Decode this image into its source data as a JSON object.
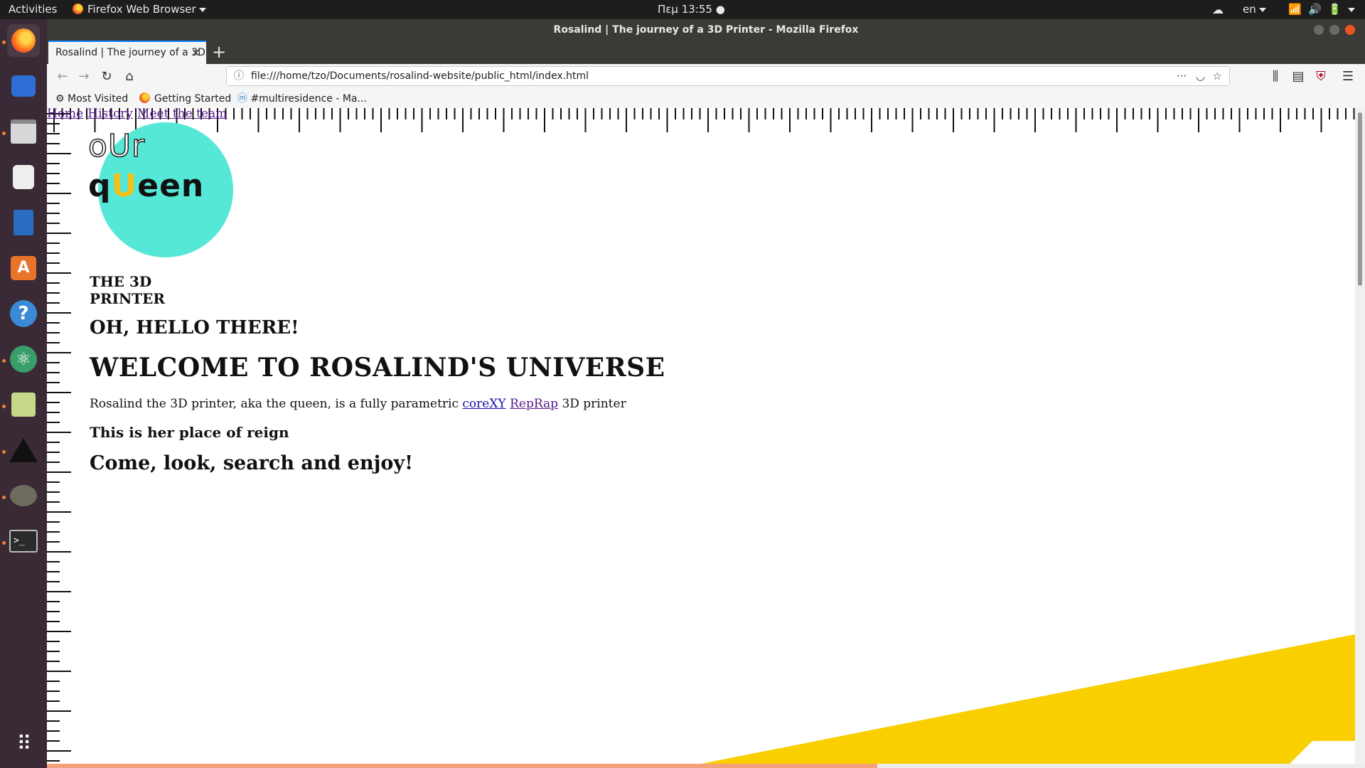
{
  "system_bar": {
    "activities": "Activities",
    "app_menu": "Firefox Web Browser",
    "clock": "Πεμ 13:55",
    "language": "en"
  },
  "window": {
    "title": "Rosalind | The journey of a 3D Printer - Mozilla Firefox"
  },
  "launcher": {
    "apps": [
      "firefox-icon",
      "thunderbird-icon",
      "files-icon",
      "rhythmbox-icon",
      "writer-icon",
      "software-center-icon",
      "help-icon",
      "atom-icon",
      "image-viewer-icon",
      "inkscape-icon",
      "gimp-icon",
      "terminal-icon",
      "app-grid-icon"
    ]
  },
  "tab": {
    "label": "Rosalind | The journey of a 3D Printer",
    "close": "×",
    "new_tab": "+"
  },
  "nav": {
    "url": "file:///home/tzo/Documents/rosalind-website/public_html/index.html",
    "more": "···"
  },
  "bookmarks": [
    "Most Visited",
    "Getting Started",
    "#multiresidence - Ma..."
  ],
  "page": {
    "nav_links": [
      "Home",
      "History",
      "Meet the team"
    ],
    "logo_line1": {
      "a": "o",
      "b": "U",
      "c": "r"
    },
    "logo_line2": {
      "a": "q",
      "b": "U",
      "c": "een"
    },
    "tagline": "THE 3D PRINTER",
    "greeting": "OH, HELLO THERE!",
    "welcome": "WELCOME TO ROSALIND'S UNIVERSE",
    "intro_start": "Rosalind the 3D printer, aka the queen, is a fully parametric",
    "link_corexy": "coreXY",
    "link_reprap": "RepRap",
    "intro_end": "3D printer",
    "reign": "This is her place of reign",
    "enjoy": "Come, look, search and enjoy!"
  },
  "colors": {
    "accent_turquoise": "#55e8d7",
    "accent_yellow": "#f9cf00",
    "link": "#1a0dab",
    "link_visited": "#551a8b"
  },
  "load_progress": 0.63
}
